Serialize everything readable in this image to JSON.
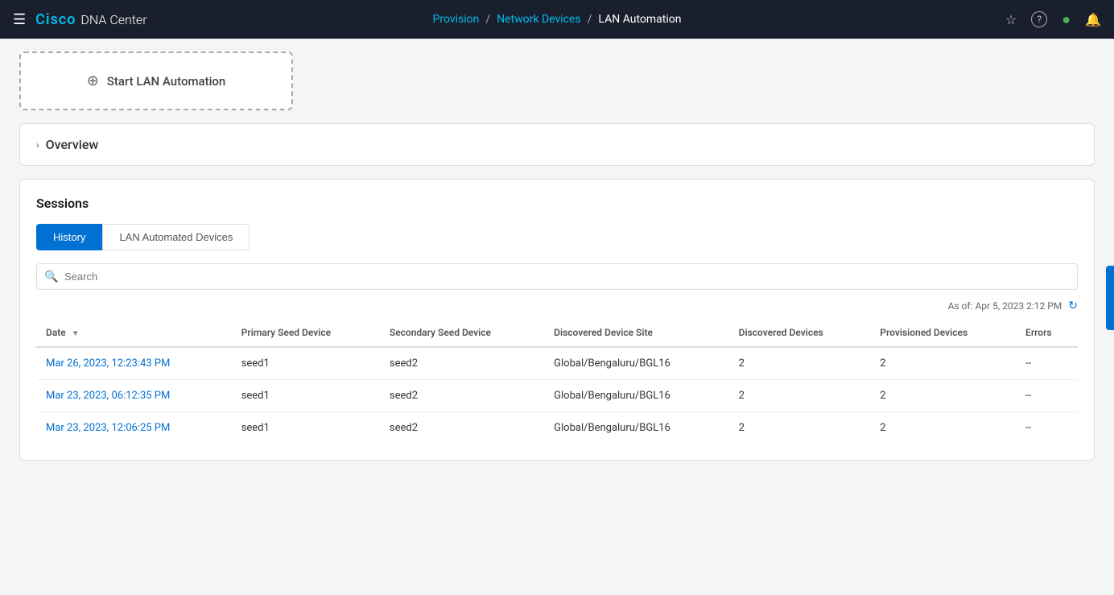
{
  "nav": {
    "menu_icon": "☰",
    "cisco_label": "Cisco",
    "dna_center_label": "DNA Center",
    "breadcrumb": {
      "provision": "Provision",
      "sep1": "/",
      "network_devices": "Network Devices",
      "sep2": "/",
      "lan_automation": "LAN Automation"
    },
    "icons": {
      "star": "☆",
      "help": "?",
      "status": "●",
      "bell": "🔔"
    }
  },
  "start_lan": {
    "icon": "⊕",
    "label": "Start LAN Automation"
  },
  "overview": {
    "chevron": "›",
    "title": "Overview"
  },
  "sessions": {
    "title": "Sessions",
    "tabs": {
      "history": "History",
      "lan_automated_devices": "LAN Automated Devices"
    },
    "search_placeholder": "Search",
    "timestamp": "As of: Apr 5, 2023 2:12 PM",
    "refresh_icon": "↻",
    "table": {
      "columns": [
        {
          "key": "date",
          "label": "Date",
          "sortable": true
        },
        {
          "key": "primary_seed",
          "label": "Primary Seed Device"
        },
        {
          "key": "secondary_seed",
          "label": "Secondary Seed Device"
        },
        {
          "key": "discovered_site",
          "label": "Discovered Device Site"
        },
        {
          "key": "discovered_devices",
          "label": "Discovered Devices"
        },
        {
          "key": "provisioned_devices",
          "label": "Provisioned Devices"
        },
        {
          "key": "errors",
          "label": "Errors"
        }
      ],
      "rows": [
        {
          "date": "Mar 26, 2023, 12:23:43 PM",
          "primary_seed": "seed1",
          "secondary_seed": "seed2",
          "discovered_site": "Global/Bengaluru/BGL16",
          "discovered_devices": "2",
          "provisioned_devices": "2",
          "errors": "--"
        },
        {
          "date": "Mar 23, 2023, 06:12:35 PM",
          "primary_seed": "seed1",
          "secondary_seed": "seed2",
          "discovered_site": "Global/Bengaluru/BGL16",
          "discovered_devices": "2",
          "provisioned_devices": "2",
          "errors": "--"
        },
        {
          "date": "Mar 23, 2023, 12:06:25 PM",
          "primary_seed": "seed1",
          "secondary_seed": "seed2",
          "discovered_site": "Global/Bengaluru/BGL16",
          "discovered_devices": "2",
          "provisioned_devices": "2",
          "errors": "--"
        }
      ]
    }
  }
}
